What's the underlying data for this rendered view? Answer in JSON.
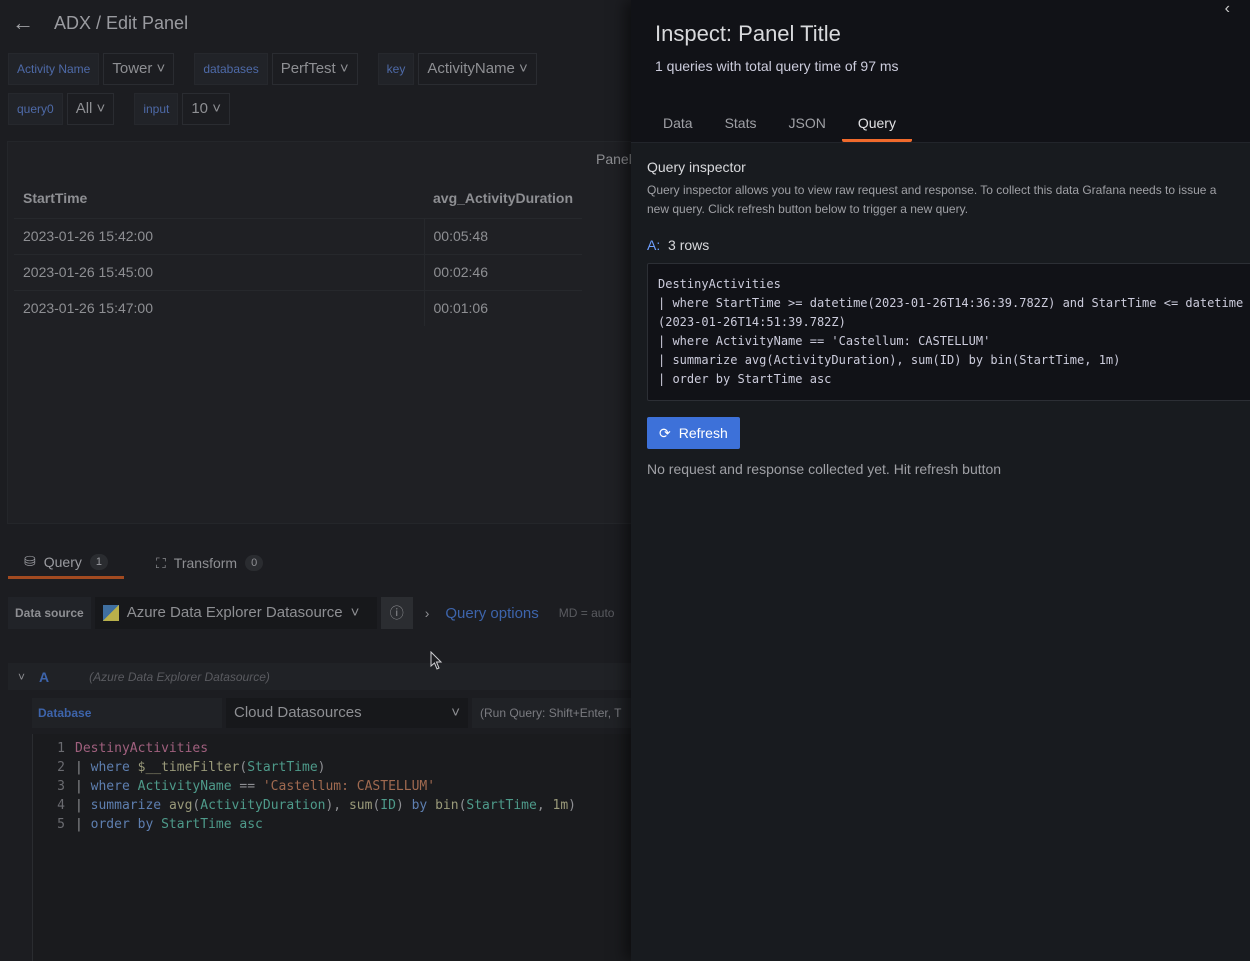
{
  "header": {
    "title": "ADX / Edit Panel"
  },
  "variables": [
    {
      "label": "Activity Name",
      "value": "Tower"
    },
    {
      "label": "databases",
      "value": "PerfTest"
    },
    {
      "label": "key",
      "value": "ActivityName"
    },
    {
      "label": "query0",
      "value": "All"
    },
    {
      "label": "input",
      "value": "10"
    }
  ],
  "panel": {
    "title": "Panel",
    "columns": [
      "StartTime",
      "avg_ActivityDuration"
    ],
    "rows": [
      [
        "2023-01-26 15:42:00",
        "00:05:48"
      ],
      [
        "2023-01-26 15:45:00",
        "00:02:46"
      ],
      [
        "2023-01-26 15:47:00",
        "00:01:06"
      ]
    ]
  },
  "editor_tabs": [
    {
      "label": "Query",
      "count": "1"
    },
    {
      "label": "Transform",
      "count": "0"
    }
  ],
  "datasource": {
    "label": "Data source",
    "value": "Azure Data Explorer Datasource",
    "query_options": "Query options",
    "md": "MD = auto"
  },
  "query_row": {
    "letter": "A",
    "source": "(Azure Data Explorer Datasource)"
  },
  "database": {
    "label": "Database",
    "value": "Cloud Datasources",
    "hint": "(Run Query: Shift+Enter, T"
  },
  "code_lines": [
    "1",
    "2",
    "3",
    "4",
    "5"
  ],
  "inspect": {
    "title": "Inspect: Panel Title",
    "subtitle": "1 queries with total query time of 97 ms",
    "tabs": [
      "Data",
      "Stats",
      "JSON",
      "Query"
    ],
    "active_tab": "Query",
    "heading": "Query inspector",
    "description": "Query inspector allows you to view raw request and response. To collect this data Grafana needs to issue a new query. Click refresh button below to trigger a new query.",
    "query_letter": "A:",
    "rows": "3 rows",
    "query_text": "DestinyActivities\n| where StartTime >= datetime(2023-01-26T14:36:39.782Z) and StartTime <= datetime(2023-01-26T14:51:39.782Z)\n| where ActivityName == 'Castellum: CASTELLUM'\n| summarize avg(ActivityDuration), sum(ID) by bin(StartTime, 1m)\n| order by StartTime asc",
    "refresh_label": "Refresh",
    "status": "No request and response collected yet. Hit refresh button"
  },
  "colors": {
    "accent": "#f06a2c",
    "primary": "#3d71d9",
    "link": "#6e9fff"
  }
}
